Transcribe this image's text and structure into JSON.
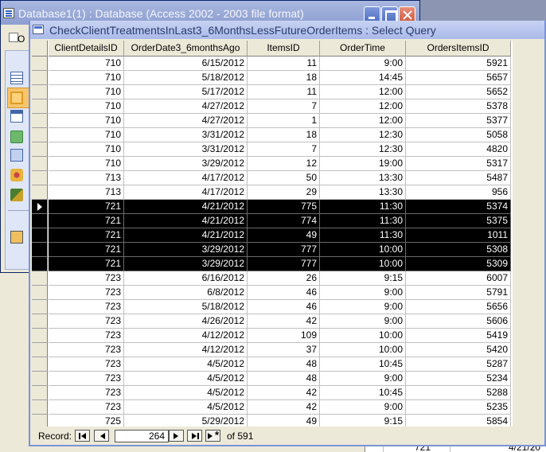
{
  "db_window": {
    "title": "Database1(1) : Database (Access 2002 - 2003 file format)",
    "open_label": "O"
  },
  "query_window": {
    "title": "CheckClientTreatmentsInLast3_6MonthsLessFutureOrderItems : Select Query"
  },
  "columns": [
    "ClientDetailsID",
    "OrderDate3_6monthsAgo",
    "ItemsID",
    "OrderTime",
    "OrdersItemsID"
  ],
  "rows": [
    [
      "710",
      "6/15/2012",
      "11",
      "9:00",
      "5921"
    ],
    [
      "710",
      "5/18/2012",
      "18",
      "14:45",
      "5657"
    ],
    [
      "710",
      "5/17/2012",
      "11",
      "12:00",
      "5652"
    ],
    [
      "710",
      "4/27/2012",
      "7",
      "12:00",
      "5378"
    ],
    [
      "710",
      "4/27/2012",
      "1",
      "12:00",
      "5377"
    ],
    [
      "710",
      "3/31/2012",
      "18",
      "12:30",
      "5058"
    ],
    [
      "710",
      "3/31/2012",
      "7",
      "12:30",
      "4820"
    ],
    [
      "710",
      "3/29/2012",
      "12",
      "19:00",
      "5317"
    ],
    [
      "713",
      "4/17/2012",
      "50",
      "13:30",
      "5487"
    ],
    [
      "713",
      "4/17/2012",
      "29",
      "13:30",
      "956"
    ],
    [
      "721",
      "4/21/2012",
      "775",
      "11:30",
      "5374"
    ],
    [
      "721",
      "4/21/2012",
      "774",
      "11:30",
      "5375"
    ],
    [
      "721",
      "4/21/2012",
      "49",
      "11:30",
      "1011"
    ],
    [
      "721",
      "3/29/2012",
      "777",
      "10:00",
      "5308"
    ],
    [
      "721",
      "3/29/2012",
      "777",
      "10:00",
      "5309"
    ],
    [
      "723",
      "6/16/2012",
      "26",
      "9:15",
      "6007"
    ],
    [
      "723",
      "6/8/2012",
      "46",
      "9:00",
      "5791"
    ],
    [
      "723",
      "5/18/2012",
      "46",
      "9:00",
      "5656"
    ],
    [
      "723",
      "4/26/2012",
      "42",
      "9:00",
      "5606"
    ],
    [
      "723",
      "4/12/2012",
      "109",
      "10:00",
      "5419"
    ],
    [
      "723",
      "4/12/2012",
      "37",
      "10:00",
      "5420"
    ],
    [
      "723",
      "4/5/2012",
      "48",
      "10:45",
      "5287"
    ],
    [
      "723",
      "4/5/2012",
      "48",
      "9:00",
      "5234"
    ],
    [
      "723",
      "4/5/2012",
      "42",
      "10:45",
      "5288"
    ],
    [
      "723",
      "4/5/2012",
      "42",
      "9:00",
      "5235"
    ],
    [
      "725",
      "5/29/2012",
      "49",
      "9:15",
      "5854"
    ]
  ],
  "selected_rows": [
    10,
    11,
    12,
    13,
    14
  ],
  "current_row": 10,
  "navigation": {
    "label": "Record:",
    "current": "264",
    "of_text": "of 591"
  },
  "background_sheet": {
    "id_text": "721",
    "date_text": "4/21/20"
  }
}
